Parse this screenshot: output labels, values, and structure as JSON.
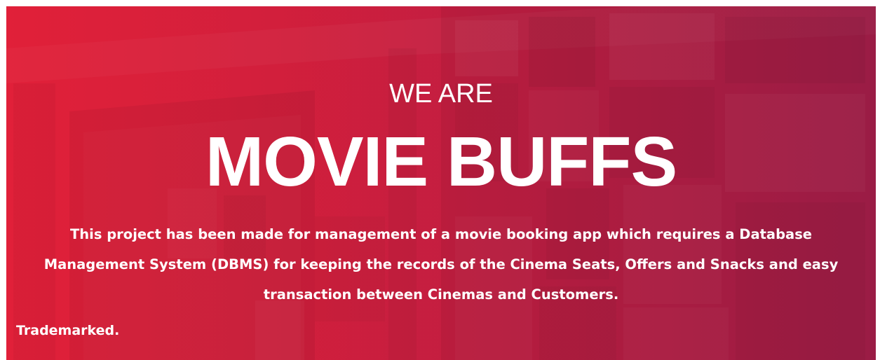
{
  "hero": {
    "kicker": "WE ARE",
    "title": "MOVIE BUFFS",
    "description": "This project has been made for management of a movie booking app which requires a Database Management System (DBMS) for keeping the records of the Cinema Seats, Offers and Snacks and easy transaction between Cinemas and Customers."
  },
  "footer": {
    "trademark": "Trademarked."
  },
  "colors": {
    "primary_red": "#e0203a",
    "text": "#ffffff"
  }
}
